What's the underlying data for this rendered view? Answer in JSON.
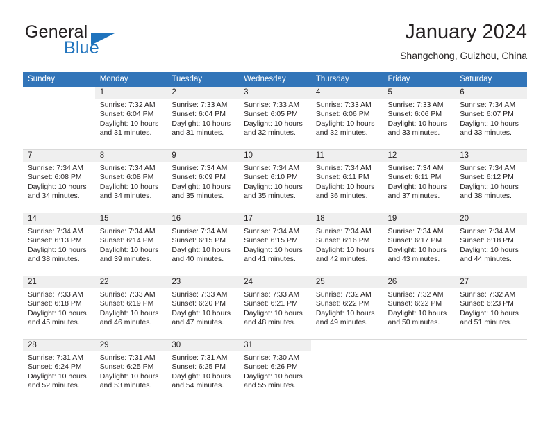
{
  "brand": {
    "line1": "General",
    "line2": "Blue",
    "accent_color": "#1f73bd",
    "triangle_icon": "triangle-icon"
  },
  "header": {
    "title": "January 2024",
    "subtitle": "Shangchong, Guizhou, China"
  },
  "theme": {
    "header_bg": "#3275b9",
    "daynum_bg": "#efefef",
    "row_divider": "#d9d9d9",
    "text": "#231f20"
  },
  "columns": [
    "Sunday",
    "Monday",
    "Tuesday",
    "Wednesday",
    "Thursday",
    "Friday",
    "Saturday"
  ],
  "weeks": [
    [
      {
        "day": "",
        "sunrise": "",
        "sunset": "",
        "daylight1": "",
        "daylight2": ""
      },
      {
        "day": "1",
        "sunrise": "Sunrise: 7:32 AM",
        "sunset": "Sunset: 6:04 PM",
        "daylight1": "Daylight: 10 hours",
        "daylight2": "and 31 minutes."
      },
      {
        "day": "2",
        "sunrise": "Sunrise: 7:33 AM",
        "sunset": "Sunset: 6:04 PM",
        "daylight1": "Daylight: 10 hours",
        "daylight2": "and 31 minutes."
      },
      {
        "day": "3",
        "sunrise": "Sunrise: 7:33 AM",
        "sunset": "Sunset: 6:05 PM",
        "daylight1": "Daylight: 10 hours",
        "daylight2": "and 32 minutes."
      },
      {
        "day": "4",
        "sunrise": "Sunrise: 7:33 AM",
        "sunset": "Sunset: 6:06 PM",
        "daylight1": "Daylight: 10 hours",
        "daylight2": "and 32 minutes."
      },
      {
        "day": "5",
        "sunrise": "Sunrise: 7:33 AM",
        "sunset": "Sunset: 6:06 PM",
        "daylight1": "Daylight: 10 hours",
        "daylight2": "and 33 minutes."
      },
      {
        "day": "6",
        "sunrise": "Sunrise: 7:34 AM",
        "sunset": "Sunset: 6:07 PM",
        "daylight1": "Daylight: 10 hours",
        "daylight2": "and 33 minutes."
      }
    ],
    [
      {
        "day": "7",
        "sunrise": "Sunrise: 7:34 AM",
        "sunset": "Sunset: 6:08 PM",
        "daylight1": "Daylight: 10 hours",
        "daylight2": "and 34 minutes."
      },
      {
        "day": "8",
        "sunrise": "Sunrise: 7:34 AM",
        "sunset": "Sunset: 6:08 PM",
        "daylight1": "Daylight: 10 hours",
        "daylight2": "and 34 minutes."
      },
      {
        "day": "9",
        "sunrise": "Sunrise: 7:34 AM",
        "sunset": "Sunset: 6:09 PM",
        "daylight1": "Daylight: 10 hours",
        "daylight2": "and 35 minutes."
      },
      {
        "day": "10",
        "sunrise": "Sunrise: 7:34 AM",
        "sunset": "Sunset: 6:10 PM",
        "daylight1": "Daylight: 10 hours",
        "daylight2": "and 35 minutes."
      },
      {
        "day": "11",
        "sunrise": "Sunrise: 7:34 AM",
        "sunset": "Sunset: 6:11 PM",
        "daylight1": "Daylight: 10 hours",
        "daylight2": "and 36 minutes."
      },
      {
        "day": "12",
        "sunrise": "Sunrise: 7:34 AM",
        "sunset": "Sunset: 6:11 PM",
        "daylight1": "Daylight: 10 hours",
        "daylight2": "and 37 minutes."
      },
      {
        "day": "13",
        "sunrise": "Sunrise: 7:34 AM",
        "sunset": "Sunset: 6:12 PM",
        "daylight1": "Daylight: 10 hours",
        "daylight2": "and 38 minutes."
      }
    ],
    [
      {
        "day": "14",
        "sunrise": "Sunrise: 7:34 AM",
        "sunset": "Sunset: 6:13 PM",
        "daylight1": "Daylight: 10 hours",
        "daylight2": "and 38 minutes."
      },
      {
        "day": "15",
        "sunrise": "Sunrise: 7:34 AM",
        "sunset": "Sunset: 6:14 PM",
        "daylight1": "Daylight: 10 hours",
        "daylight2": "and 39 minutes."
      },
      {
        "day": "16",
        "sunrise": "Sunrise: 7:34 AM",
        "sunset": "Sunset: 6:15 PM",
        "daylight1": "Daylight: 10 hours",
        "daylight2": "and 40 minutes."
      },
      {
        "day": "17",
        "sunrise": "Sunrise: 7:34 AM",
        "sunset": "Sunset: 6:15 PM",
        "daylight1": "Daylight: 10 hours",
        "daylight2": "and 41 minutes."
      },
      {
        "day": "18",
        "sunrise": "Sunrise: 7:34 AM",
        "sunset": "Sunset: 6:16 PM",
        "daylight1": "Daylight: 10 hours",
        "daylight2": "and 42 minutes."
      },
      {
        "day": "19",
        "sunrise": "Sunrise: 7:34 AM",
        "sunset": "Sunset: 6:17 PM",
        "daylight1": "Daylight: 10 hours",
        "daylight2": "and 43 minutes."
      },
      {
        "day": "20",
        "sunrise": "Sunrise: 7:34 AM",
        "sunset": "Sunset: 6:18 PM",
        "daylight1": "Daylight: 10 hours",
        "daylight2": "and 44 minutes."
      }
    ],
    [
      {
        "day": "21",
        "sunrise": "Sunrise: 7:33 AM",
        "sunset": "Sunset: 6:18 PM",
        "daylight1": "Daylight: 10 hours",
        "daylight2": "and 45 minutes."
      },
      {
        "day": "22",
        "sunrise": "Sunrise: 7:33 AM",
        "sunset": "Sunset: 6:19 PM",
        "daylight1": "Daylight: 10 hours",
        "daylight2": "and 46 minutes."
      },
      {
        "day": "23",
        "sunrise": "Sunrise: 7:33 AM",
        "sunset": "Sunset: 6:20 PM",
        "daylight1": "Daylight: 10 hours",
        "daylight2": "and 47 minutes."
      },
      {
        "day": "24",
        "sunrise": "Sunrise: 7:33 AM",
        "sunset": "Sunset: 6:21 PM",
        "daylight1": "Daylight: 10 hours",
        "daylight2": "and 48 minutes."
      },
      {
        "day": "25",
        "sunrise": "Sunrise: 7:32 AM",
        "sunset": "Sunset: 6:22 PM",
        "daylight1": "Daylight: 10 hours",
        "daylight2": "and 49 minutes."
      },
      {
        "day": "26",
        "sunrise": "Sunrise: 7:32 AM",
        "sunset": "Sunset: 6:22 PM",
        "daylight1": "Daylight: 10 hours",
        "daylight2": "and 50 minutes."
      },
      {
        "day": "27",
        "sunrise": "Sunrise: 7:32 AM",
        "sunset": "Sunset: 6:23 PM",
        "daylight1": "Daylight: 10 hours",
        "daylight2": "and 51 minutes."
      }
    ],
    [
      {
        "day": "28",
        "sunrise": "Sunrise: 7:31 AM",
        "sunset": "Sunset: 6:24 PM",
        "daylight1": "Daylight: 10 hours",
        "daylight2": "and 52 minutes."
      },
      {
        "day": "29",
        "sunrise": "Sunrise: 7:31 AM",
        "sunset": "Sunset: 6:25 PM",
        "daylight1": "Daylight: 10 hours",
        "daylight2": "and 53 minutes."
      },
      {
        "day": "30",
        "sunrise": "Sunrise: 7:31 AM",
        "sunset": "Sunset: 6:25 PM",
        "daylight1": "Daylight: 10 hours",
        "daylight2": "and 54 minutes."
      },
      {
        "day": "31",
        "sunrise": "Sunrise: 7:30 AM",
        "sunset": "Sunset: 6:26 PM",
        "daylight1": "Daylight: 10 hours",
        "daylight2": "and 55 minutes."
      },
      {
        "day": "",
        "sunrise": "",
        "sunset": "",
        "daylight1": "",
        "daylight2": ""
      },
      {
        "day": "",
        "sunrise": "",
        "sunset": "",
        "daylight1": "",
        "daylight2": ""
      },
      {
        "day": "",
        "sunrise": "",
        "sunset": "",
        "daylight1": "",
        "daylight2": ""
      }
    ]
  ]
}
